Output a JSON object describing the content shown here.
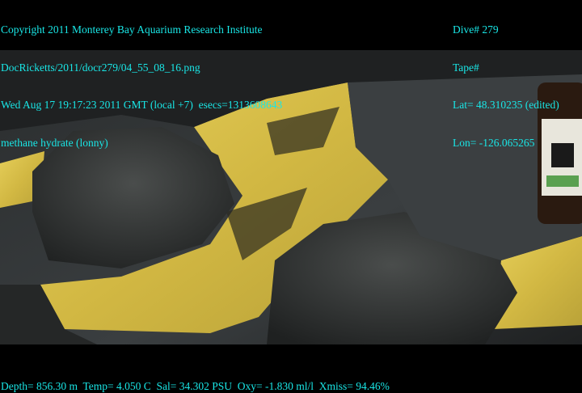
{
  "header_left": {
    "copyright": "Copyright 2011 Monterey Bay Aquarium Research Institute",
    "file_path": "DocRicketts/2011/docr279/04_55_08_16.png",
    "timestamp": "Wed Aug 17 19:17:23 2011 GMT (local +7)  esecs=1313608643",
    "description": "methane hydrate (lonny)"
  },
  "header_right": {
    "dive": "Dive# 279",
    "tape": "Tape#",
    "lat": "Lat= 48.310235 (edited)",
    "lon": "Lon= -126.065265"
  },
  "footer": {
    "telemetry": "Depth= 856.30 m  Temp= 4.050 C  Sal= 34.302 PSU  Oxy= -1.830 ml/l  Xmiss= 94.46%"
  },
  "colors": {
    "overlay_text": "#19e6e6",
    "hydrate": "#d9c24a",
    "rock": "#3c3f40"
  }
}
